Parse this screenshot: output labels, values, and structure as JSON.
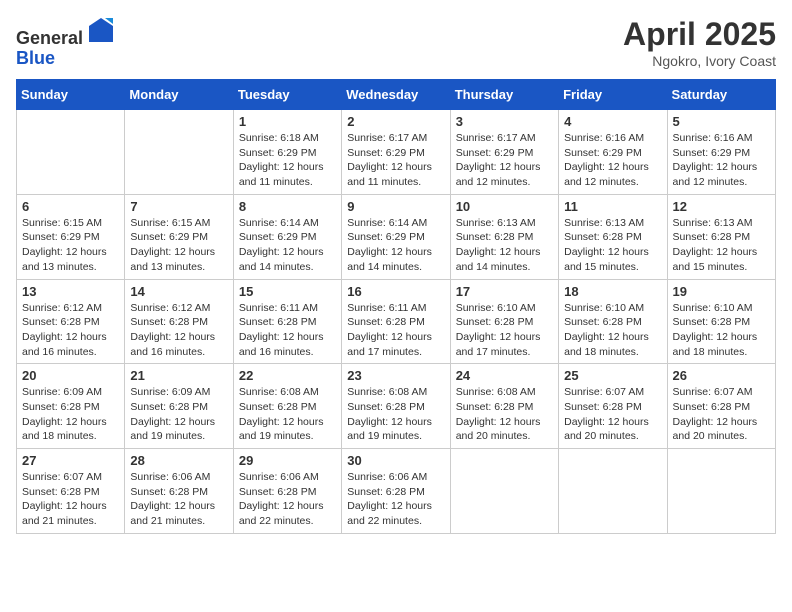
{
  "header": {
    "logo_line1": "General",
    "logo_line2": "Blue",
    "month_title": "April 2025",
    "location": "Ngokro, Ivory Coast"
  },
  "weekdays": [
    "Sunday",
    "Monday",
    "Tuesday",
    "Wednesday",
    "Thursday",
    "Friday",
    "Saturday"
  ],
  "weeks": [
    [
      {
        "day": "",
        "info": ""
      },
      {
        "day": "",
        "info": ""
      },
      {
        "day": "1",
        "info": "Sunrise: 6:18 AM\nSunset: 6:29 PM\nDaylight: 12 hours and 11 minutes."
      },
      {
        "day": "2",
        "info": "Sunrise: 6:17 AM\nSunset: 6:29 PM\nDaylight: 12 hours and 11 minutes."
      },
      {
        "day": "3",
        "info": "Sunrise: 6:17 AM\nSunset: 6:29 PM\nDaylight: 12 hours and 12 minutes."
      },
      {
        "day": "4",
        "info": "Sunrise: 6:16 AM\nSunset: 6:29 PM\nDaylight: 12 hours and 12 minutes."
      },
      {
        "day": "5",
        "info": "Sunrise: 6:16 AM\nSunset: 6:29 PM\nDaylight: 12 hours and 12 minutes."
      }
    ],
    [
      {
        "day": "6",
        "info": "Sunrise: 6:15 AM\nSunset: 6:29 PM\nDaylight: 12 hours and 13 minutes."
      },
      {
        "day": "7",
        "info": "Sunrise: 6:15 AM\nSunset: 6:29 PM\nDaylight: 12 hours and 13 minutes."
      },
      {
        "day": "8",
        "info": "Sunrise: 6:14 AM\nSunset: 6:29 PM\nDaylight: 12 hours and 14 minutes."
      },
      {
        "day": "9",
        "info": "Sunrise: 6:14 AM\nSunset: 6:29 PM\nDaylight: 12 hours and 14 minutes."
      },
      {
        "day": "10",
        "info": "Sunrise: 6:13 AM\nSunset: 6:28 PM\nDaylight: 12 hours and 14 minutes."
      },
      {
        "day": "11",
        "info": "Sunrise: 6:13 AM\nSunset: 6:28 PM\nDaylight: 12 hours and 15 minutes."
      },
      {
        "day": "12",
        "info": "Sunrise: 6:13 AM\nSunset: 6:28 PM\nDaylight: 12 hours and 15 minutes."
      }
    ],
    [
      {
        "day": "13",
        "info": "Sunrise: 6:12 AM\nSunset: 6:28 PM\nDaylight: 12 hours and 16 minutes."
      },
      {
        "day": "14",
        "info": "Sunrise: 6:12 AM\nSunset: 6:28 PM\nDaylight: 12 hours and 16 minutes."
      },
      {
        "day": "15",
        "info": "Sunrise: 6:11 AM\nSunset: 6:28 PM\nDaylight: 12 hours and 16 minutes."
      },
      {
        "day": "16",
        "info": "Sunrise: 6:11 AM\nSunset: 6:28 PM\nDaylight: 12 hours and 17 minutes."
      },
      {
        "day": "17",
        "info": "Sunrise: 6:10 AM\nSunset: 6:28 PM\nDaylight: 12 hours and 17 minutes."
      },
      {
        "day": "18",
        "info": "Sunrise: 6:10 AM\nSunset: 6:28 PM\nDaylight: 12 hours and 18 minutes."
      },
      {
        "day": "19",
        "info": "Sunrise: 6:10 AM\nSunset: 6:28 PM\nDaylight: 12 hours and 18 minutes."
      }
    ],
    [
      {
        "day": "20",
        "info": "Sunrise: 6:09 AM\nSunset: 6:28 PM\nDaylight: 12 hours and 18 minutes."
      },
      {
        "day": "21",
        "info": "Sunrise: 6:09 AM\nSunset: 6:28 PM\nDaylight: 12 hours and 19 minutes."
      },
      {
        "day": "22",
        "info": "Sunrise: 6:08 AM\nSunset: 6:28 PM\nDaylight: 12 hours and 19 minutes."
      },
      {
        "day": "23",
        "info": "Sunrise: 6:08 AM\nSunset: 6:28 PM\nDaylight: 12 hours and 19 minutes."
      },
      {
        "day": "24",
        "info": "Sunrise: 6:08 AM\nSunset: 6:28 PM\nDaylight: 12 hours and 20 minutes."
      },
      {
        "day": "25",
        "info": "Sunrise: 6:07 AM\nSunset: 6:28 PM\nDaylight: 12 hours and 20 minutes."
      },
      {
        "day": "26",
        "info": "Sunrise: 6:07 AM\nSunset: 6:28 PM\nDaylight: 12 hours and 20 minutes."
      }
    ],
    [
      {
        "day": "27",
        "info": "Sunrise: 6:07 AM\nSunset: 6:28 PM\nDaylight: 12 hours and 21 minutes."
      },
      {
        "day": "28",
        "info": "Sunrise: 6:06 AM\nSunset: 6:28 PM\nDaylight: 12 hours and 21 minutes."
      },
      {
        "day": "29",
        "info": "Sunrise: 6:06 AM\nSunset: 6:28 PM\nDaylight: 12 hours and 22 minutes."
      },
      {
        "day": "30",
        "info": "Sunrise: 6:06 AM\nSunset: 6:28 PM\nDaylight: 12 hours and 22 minutes."
      },
      {
        "day": "",
        "info": ""
      },
      {
        "day": "",
        "info": ""
      },
      {
        "day": "",
        "info": ""
      }
    ]
  ]
}
